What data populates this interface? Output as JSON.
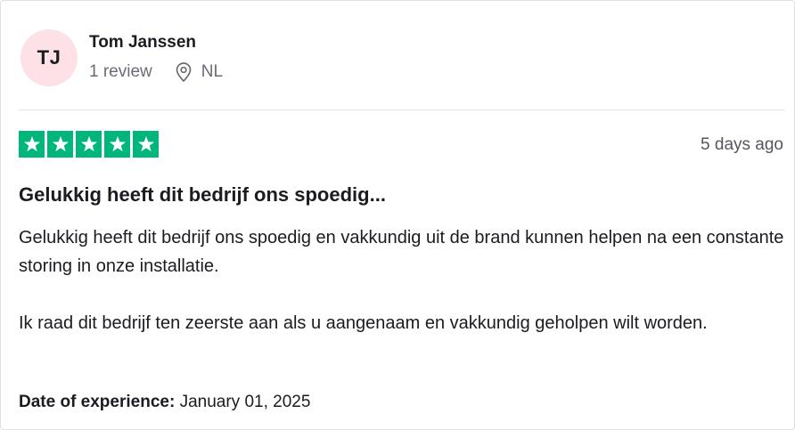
{
  "reviewer": {
    "initials": "TJ",
    "name": "Tom Janssen",
    "review_count": "1 review",
    "location": "NL",
    "avatar_color": "#fde1e6",
    "location_icon": "map-pin-icon"
  },
  "review": {
    "rating": 5,
    "max_rating": 5,
    "star_color": "#00b67a",
    "star_icon": "star-icon",
    "date": "5 days ago",
    "title": "Gelukkig heeft dit bedrijf ons spoedig...",
    "paragraphs": [
      "Gelukkig heeft dit bedrijf ons spoedig en vakkundig uit de brand kunnen helpen na een constante storing in onze installatie.",
      "Ik raad dit bedrijf ten zeerste aan als u aangenaam en vakkundig geholpen wilt worden."
    ],
    "experience_label": "Date of experience:",
    "experience_date": "January 01, 2025"
  }
}
